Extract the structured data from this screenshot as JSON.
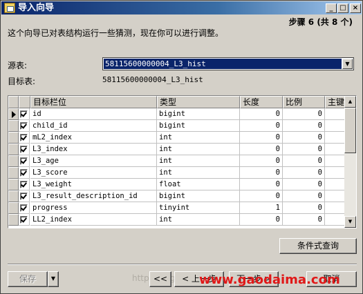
{
  "window": {
    "title": "导入向导"
  },
  "titlebar_buttons": {
    "minimize": "_",
    "maximize": "□",
    "close": "×"
  },
  "step": "步骤 6 (共 8 个)",
  "intro": "这个向导已对表结构运行一些猜测，现在你可以进行调整。",
  "source": {
    "label": "源表:",
    "value": "58115600000004_L3_hist"
  },
  "target": {
    "label": "目标表:",
    "value": "58115600000004_L3_hist"
  },
  "grid": {
    "columns": [
      "目标栏位",
      "类型",
      "长度",
      "比例",
      "主键"
    ],
    "rows": [
      {
        "name": "id",
        "type": "bigint",
        "length": "0",
        "scale": "0",
        "checked": true,
        "current": true
      },
      {
        "name": "child_id",
        "type": "bigint",
        "length": "0",
        "scale": "0",
        "checked": true
      },
      {
        "name": "mL2_index",
        "type": "int",
        "length": "0",
        "scale": "0",
        "checked": true
      },
      {
        "name": "L3_index",
        "type": "int",
        "length": "0",
        "scale": "0",
        "checked": true
      },
      {
        "name": "L3_age",
        "type": "int",
        "length": "0",
        "scale": "0",
        "checked": true
      },
      {
        "name": "L3_score",
        "type": "int",
        "length": "0",
        "scale": "0",
        "checked": true
      },
      {
        "name": "L3_weight",
        "type": "float",
        "length": "0",
        "scale": "0",
        "checked": true
      },
      {
        "name": "L3_result_description_id",
        "type": "bigint",
        "length": "0",
        "scale": "0",
        "checked": true
      },
      {
        "name": "progress",
        "type": "tinyint",
        "length": "1",
        "scale": "0",
        "checked": true
      },
      {
        "name": "LL2_index",
        "type": "int",
        "length": "0",
        "scale": "0",
        "checked": true
      }
    ]
  },
  "buttons": {
    "condition_query": "条件式查询",
    "save": "保存",
    "first": "<<",
    "prev": "< 上一步",
    "next": "下一步 >",
    "cancel": "取消"
  },
  "watermark": {
    "left": "http://blog.",
    "right": "www.gaodaima.com"
  }
}
